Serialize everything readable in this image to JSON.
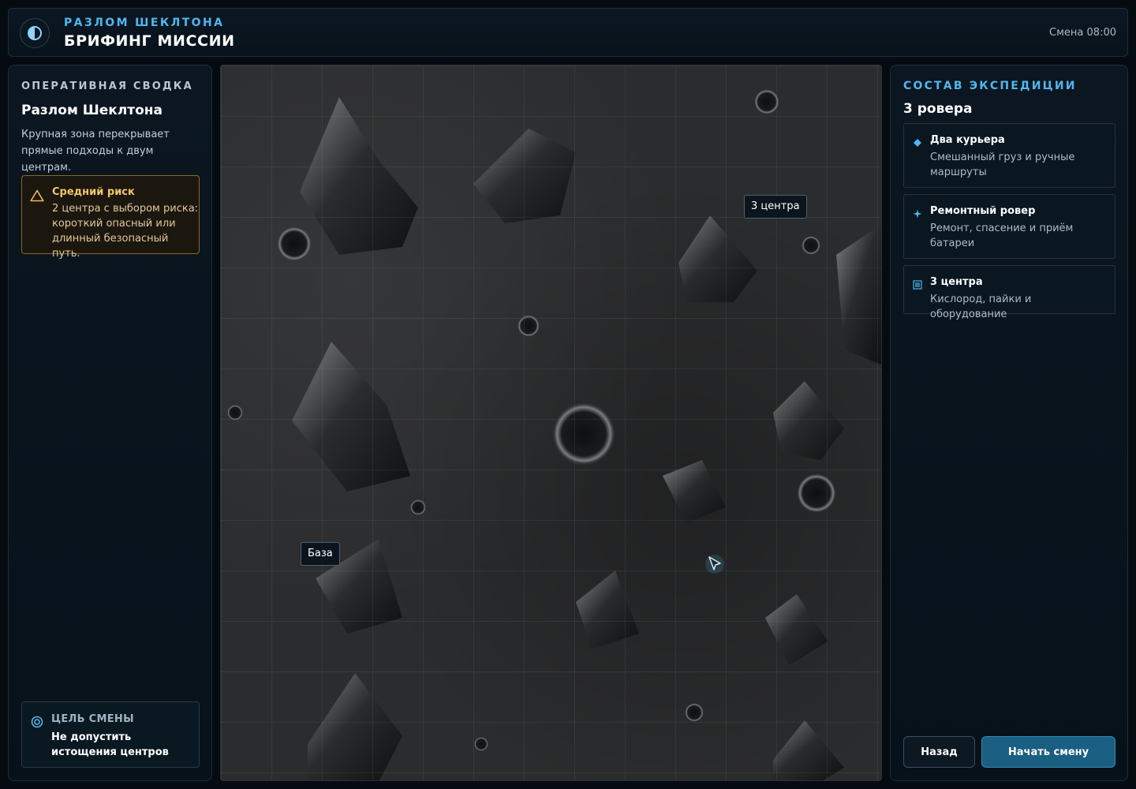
{
  "header": {
    "subtitle": "РАЗЛОМ ШЕКЛТОНА",
    "title": "БРИФИНГ МИССИИ",
    "shift": "Смена 08:00",
    "logo_icon": "half-moon-icon"
  },
  "briefing": {
    "section_label": "ОПЕРАТИВНАЯ СВОДКА",
    "title": "Разлом Шеклтона",
    "description": "Крупная зона перекрывает прямые подходы к двум центрам.",
    "risk": {
      "icon": "warning-triangle-icon",
      "title": "Средний риск",
      "text": "2 центра с выбором риска: короткий опасный или длинный безопасный путь."
    },
    "goal": {
      "icon": "target-icon",
      "label": "ЦЕЛЬ СМЕНЫ",
      "text": "Не допустить истощения центров"
    }
  },
  "map": {
    "markers": {
      "centers": "3 центра",
      "base": "База"
    },
    "rover_icon": "rover-arrow-icon"
  },
  "expedition": {
    "section_label": "СОСТАВ ЭКСПЕДИЦИИ",
    "count": "3 ровера",
    "cards": [
      {
        "icon": "diamond-icon",
        "title": "Два курьера",
        "desc": "Смешанный груз и ручные маршруты"
      },
      {
        "icon": "sparkle-icon",
        "title": "Ремонтный ровер",
        "desc": "Ремонт, спасение и приём батареи"
      },
      {
        "icon": "list-icon",
        "title": "3 центра",
        "desc": "Кислород, пайки и оборудование"
      }
    ]
  },
  "actions": {
    "back": "Назад",
    "start": "Начать смену"
  },
  "colors": {
    "accent": "#4fb7ef",
    "risk": "#f1c56a",
    "start_button": "#1a5f82"
  }
}
